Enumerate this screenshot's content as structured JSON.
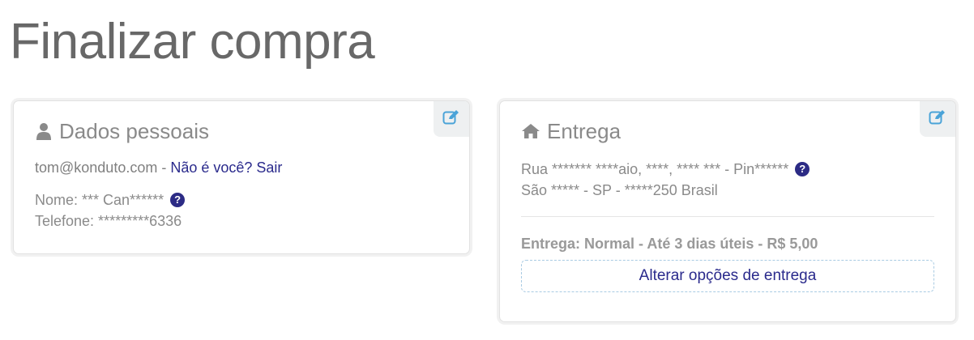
{
  "page": {
    "title": "Finalizar compra"
  },
  "personal": {
    "title": "Dados pessoais",
    "icon": "user-icon",
    "email": "tom@konduto.com",
    "separator": " - ",
    "not_you_link": "Não é você? Sair",
    "name": "Nome: *** Can******",
    "phone": "Telefone: *********6336",
    "help_glyph": "?",
    "edit_icon": "edit-icon"
  },
  "delivery": {
    "title": "Entrega",
    "icon": "home-icon",
    "address_line1": "Rua ******* ****aio, ****, **** *** - Pin******",
    "address_line2": "São ***** - SP - *****250 Brasil",
    "help_glyph": "?",
    "summary": "Entrega: Normal - Até 3 dias úteis - R$ 5,00",
    "change_button": "Alterar opções de entrega",
    "edit_icon": "edit-icon"
  },
  "colors": {
    "link": "#2a2a8c",
    "edit_icon": "#4aa3d8",
    "help_icon": "#2c2b85"
  }
}
